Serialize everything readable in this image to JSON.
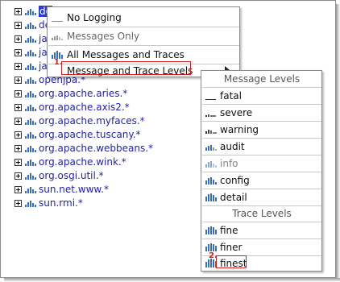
{
  "tree": {
    "rows": [
      {
        "label": "do",
        "selected": true
      },
      {
        "label": "de"
      },
      {
        "label": "ja"
      },
      {
        "label": "ja"
      },
      {
        "label": "ja"
      },
      {
        "label": "openjpa.*"
      },
      {
        "label": "org.apache.aries.*"
      },
      {
        "label": "org.apache.axis2.*"
      },
      {
        "label": "org.apache.myfaces.*"
      },
      {
        "label": "org.apache.tuscany.*"
      },
      {
        "label": "org.apache.webbeans.*"
      },
      {
        "label": "org.apache.wink.*"
      },
      {
        "label": "org.osgi.util.*"
      },
      {
        "label": "sun.net.www.*"
      },
      {
        "label": "sun.rmi.*"
      }
    ]
  },
  "menu1": {
    "items": [
      {
        "label": "No Logging",
        "icon": "no-logging-icon"
      },
      {
        "label": "Messages Only",
        "icon": "messages-only-icon",
        "dim": true
      },
      {
        "label": "All Messages and Traces",
        "icon": "all-messages-icon"
      },
      {
        "label": "Message and Trace Levels",
        "icon": "",
        "submenu": true
      }
    ],
    "callout_number": "1."
  },
  "menu2": {
    "message_header": "Message Levels",
    "message_levels": [
      {
        "label": "fatal"
      },
      {
        "label": "severe"
      },
      {
        "label": "warning"
      },
      {
        "label": "audit"
      },
      {
        "label": "info",
        "dim": true
      },
      {
        "label": "config"
      },
      {
        "label": "detail"
      }
    ],
    "trace_header": "Trace Levels",
    "trace_levels": [
      {
        "label": "fine"
      },
      {
        "label": "finer"
      },
      {
        "label": "finest"
      }
    ],
    "callout_number": "2."
  },
  "colors": {
    "link": "#2222aa",
    "selection": "#2a3ccf",
    "highlight_box": "#d21e1e",
    "level_icon": "#3a6fb8"
  }
}
